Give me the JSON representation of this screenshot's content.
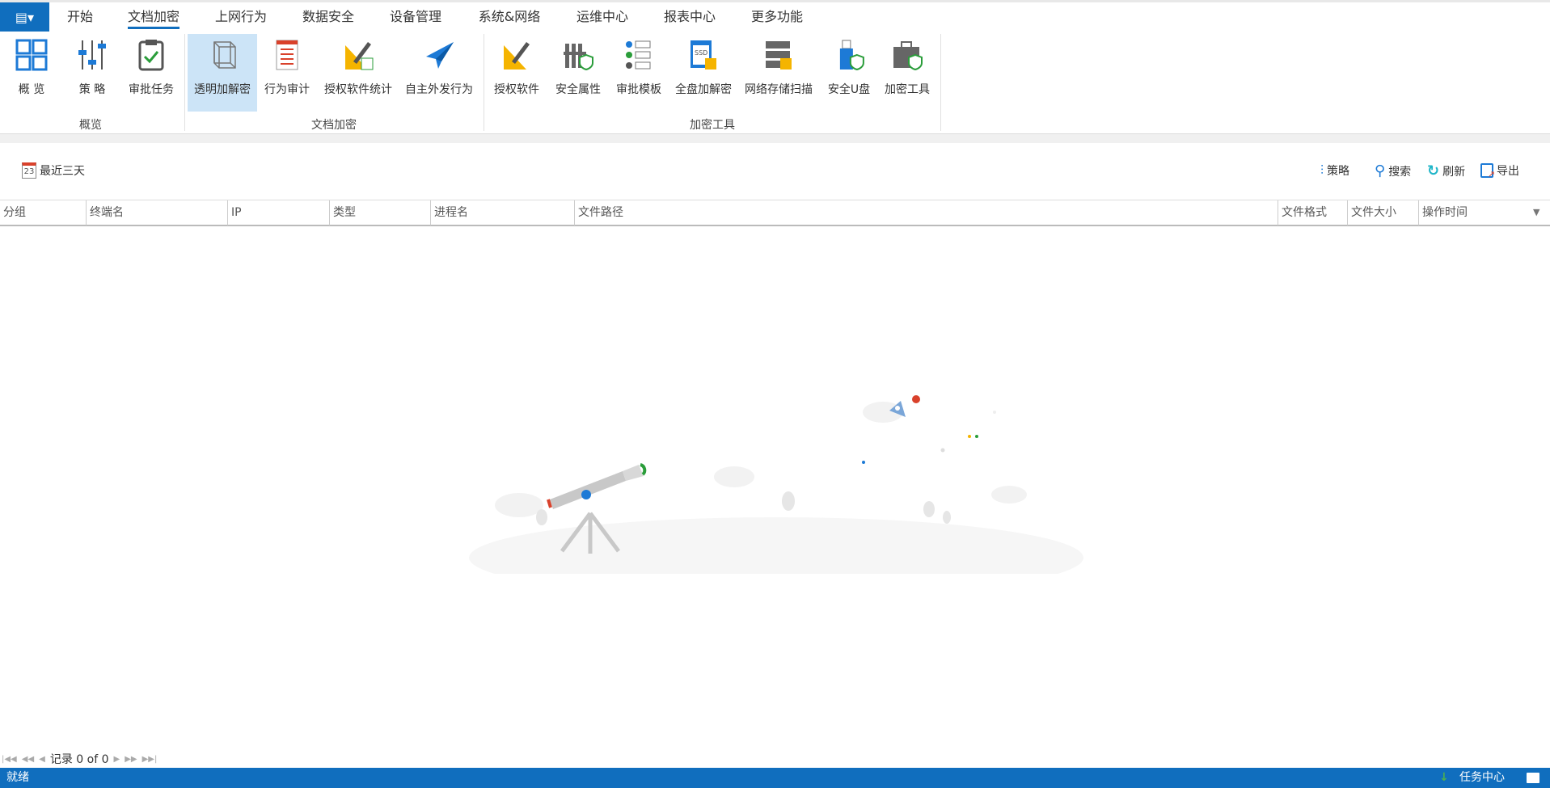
{
  "tabs": [
    "开始",
    "文档加密",
    "上网行为",
    "数据安全",
    "设备管理",
    "系统&网络",
    "运维中心",
    "报表中心",
    "更多功能"
  ],
  "active_tab": "文档加密",
  "ribbon": {
    "groups": [
      {
        "label": "概览"
      },
      {
        "label": "文档加密"
      },
      {
        "label": "加密工具"
      }
    ],
    "buttons": [
      "概 览",
      "策 略",
      "审批任务",
      "透明加解密",
      "行为审计",
      "授权软件统计",
      "自主外发行为",
      "授权软件",
      "安全属性",
      "审批模板",
      "全盘加解密",
      "网络存储扫描",
      "安全U盘",
      "加密工具"
    ]
  },
  "toolbar": {
    "date_filter": "最近三天",
    "calendar_day": "23",
    "policy": "策略",
    "search": "搜索",
    "refresh": "刷新",
    "export": "导出"
  },
  "table": {
    "columns": [
      "分组",
      "终端名",
      "IP",
      "类型",
      "进程名",
      "文件路径",
      "文件格式",
      "文件大小",
      "操作时间"
    ],
    "rows": []
  },
  "pager": {
    "label": "记录 0 of 0"
  },
  "status": {
    "left": "就绪",
    "task_center": "任务中心"
  },
  "colors": {
    "accent": "#106ebe",
    "selected": "#cce4f7"
  }
}
